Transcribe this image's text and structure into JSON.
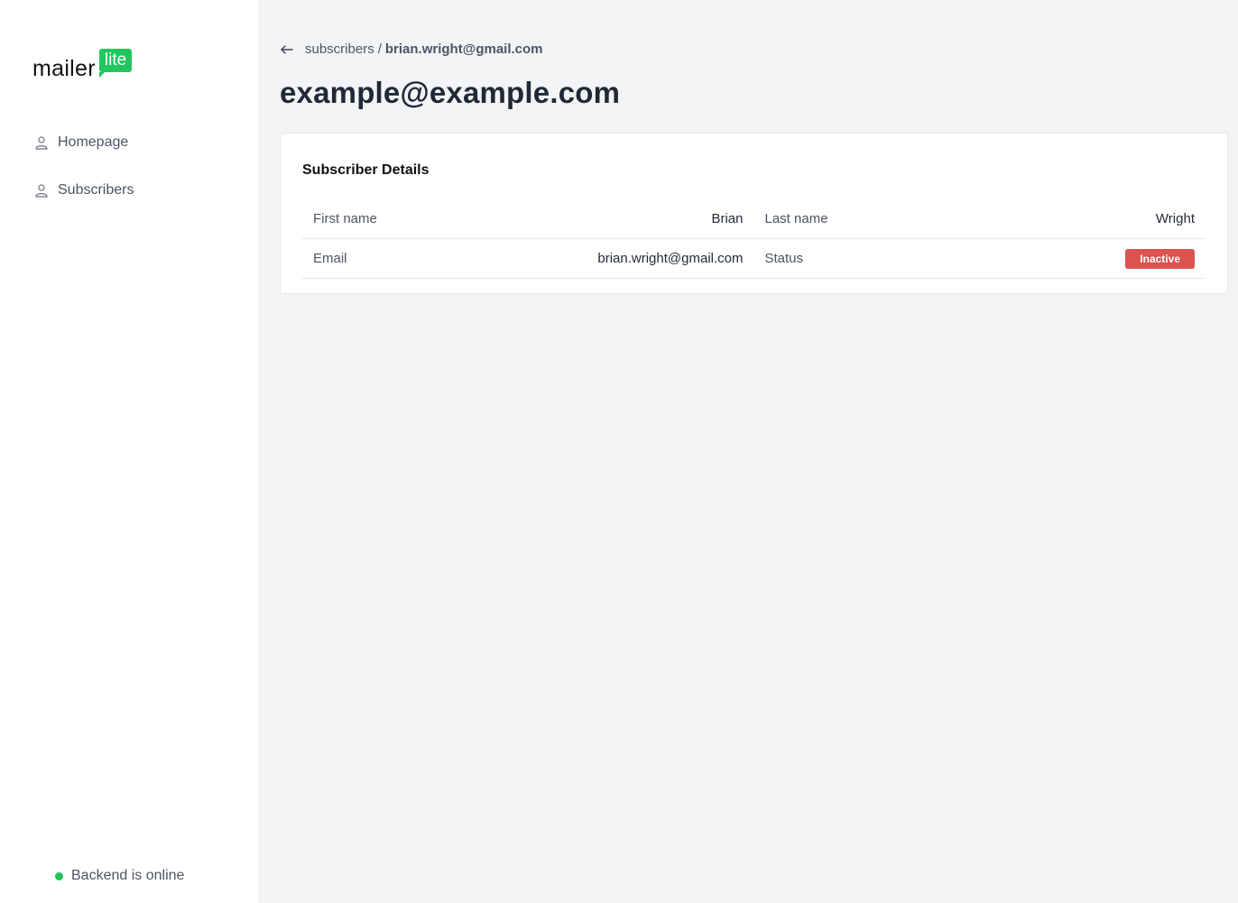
{
  "brand": {
    "word": "mailer",
    "badge": "lite",
    "accent": "#22c55e"
  },
  "nav": {
    "items": [
      {
        "label": "Homepage",
        "icon": "user-icon"
      },
      {
        "label": "Subscribers",
        "icon": "user-icon"
      }
    ]
  },
  "status": {
    "text": "Backend is online",
    "color": "#22c55e"
  },
  "breadcrumb": {
    "parent": "subscribers",
    "separator": "/",
    "current": "brian.wright@gmail.com"
  },
  "page_title": "example@example.com",
  "card": {
    "title": "Subscriber Details",
    "fields": {
      "first_name_label": "First name",
      "first_name_value": "Brian",
      "last_name_label": "Last name",
      "last_name_value": "Wright",
      "email_label": "Email",
      "email_value": "brian.wright@gmail.com",
      "status_label": "Status",
      "status_value": "Inactive",
      "status_color": "#d9534f"
    }
  }
}
